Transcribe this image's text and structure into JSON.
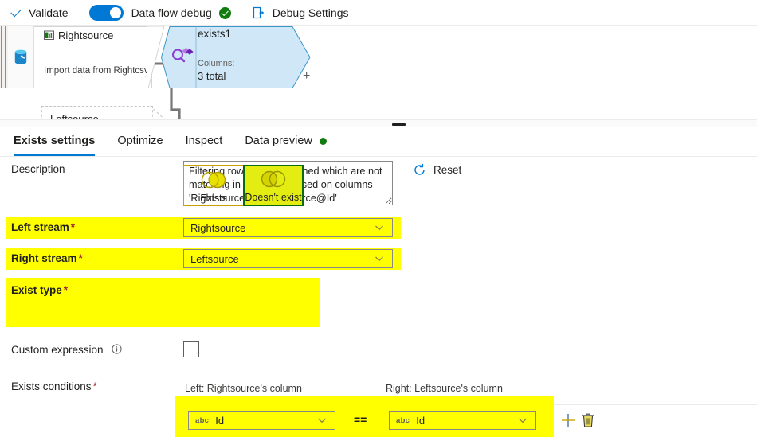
{
  "toolbar": {
    "validate_label": "Validate",
    "validate_icon": "check-icon",
    "toggle_label": "Data flow debug",
    "toggle_state": "on",
    "status_icon": "success-circle-icon",
    "debug_settings_label": "Debug Settings",
    "debug_settings_icon": "debug-export-icon"
  },
  "canvas": {
    "source_node": {
      "title": "Rightsource",
      "subtitle": "Import data from Rightcsv",
      "icon": "source-dataset-icon",
      "plus_label": "+"
    },
    "exists_node": {
      "title": "exists1",
      "columns_label": "Columns:",
      "columns_value": "3 total",
      "icon": "exists-transform-icon",
      "plus_label": "+"
    },
    "ghost_node": {
      "title": "Leftsource"
    }
  },
  "tabs": [
    {
      "label": "Exists settings",
      "active": true
    },
    {
      "label": "Optimize",
      "active": false
    },
    {
      "label": "Inspect",
      "active": false
    },
    {
      "label": "Data preview",
      "active": false,
      "badge": "green-dot"
    }
  ],
  "settings": {
    "description_label": "Description",
    "description_value": "Filtering rows from undefined which are not matching in undefined based on columns 'Rightsource@Id, Leftsource@Id'",
    "reset_label": "Reset",
    "reset_icon": "refresh-icon",
    "left_stream_label": "Left stream",
    "left_stream_value": "Rightsource",
    "right_stream_label": "Right stream",
    "right_stream_value": "Leftsource",
    "exist_type_label": "Exist type",
    "exist_type_options": [
      {
        "label": "Exists",
        "selected": false
      },
      {
        "label": "Doesn't exist",
        "selected": true
      }
    ],
    "custom_expression_label": "Custom expression",
    "custom_expression_checked": false,
    "exists_conditions_label": "Exists conditions",
    "left_column_header": "Left: Rightsource's column",
    "right_column_header": "Right: Leftsource's column",
    "required_marker": "*",
    "conditions": [
      {
        "left_type": "abc",
        "left_value": "Id",
        "operator": "==",
        "right_type": "abc",
        "right_value": "Id",
        "add_icon": "plus-icon",
        "delete_icon": "trash-icon"
      }
    ]
  },
  "colors": {
    "accent": "#0078d4",
    "highlight": "#ffff00",
    "success": "#107c10",
    "required": "#a4262c",
    "selected_border": "#0b6a0b",
    "selected_fill": "#e3ed12"
  }
}
